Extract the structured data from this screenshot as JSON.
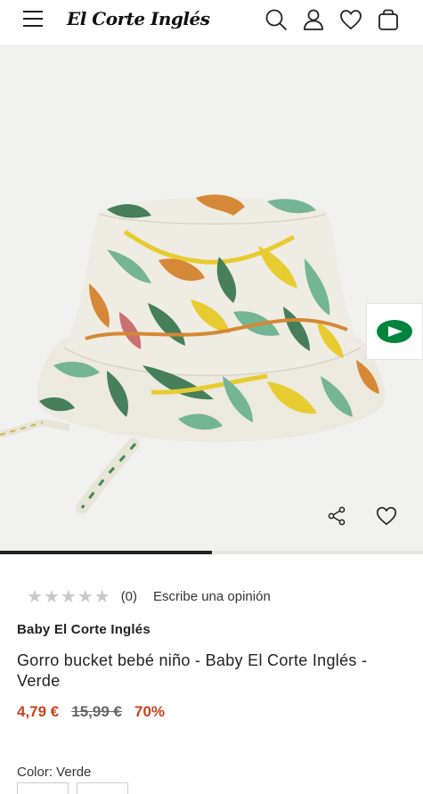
{
  "header": {
    "logo_text": "El Corte Inglés",
    "icons": [
      "menu-icon",
      "search-icon",
      "account-icon",
      "wishlist-icon",
      "cart-icon"
    ]
  },
  "product": {
    "gallery": {
      "progress": 0.5
    },
    "rating": {
      "stars_filled": 0,
      "stars_total": 5,
      "count_text": "(0)",
      "write_review": "Escribe una opinión"
    },
    "brand": "Baby El Corte Inglés",
    "title": "Gorro bucket bebé niño - Baby El Corte Inglés - Verde",
    "price_now": "4,79 €",
    "price_old": "15,99 €",
    "discount": "70%",
    "color_label": "Color: Verde"
  },
  "colors": {
    "accent_red": "#c4431d",
    "brand_green": "#00843d"
  }
}
